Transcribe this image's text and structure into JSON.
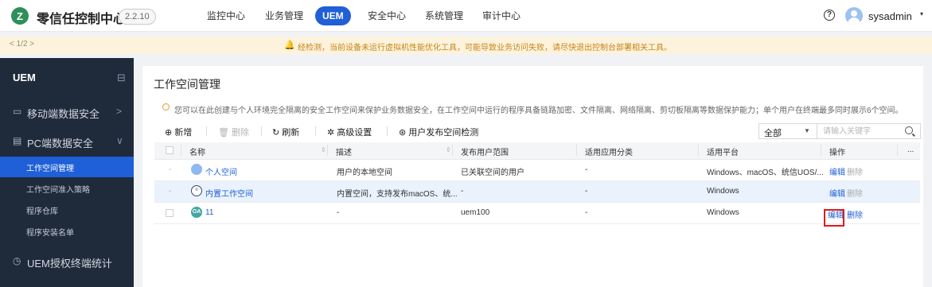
{
  "header": {
    "logo_letter": "Z",
    "title": "零信任控制中心",
    "version": "2.2.10",
    "nav": [
      "监控中心",
      "业务管理",
      "UEM",
      "安全中心",
      "系统管理",
      "审计中心"
    ],
    "active_nav": "UEM",
    "help_icon": "?",
    "username": "sysadmin",
    "caret": "▾"
  },
  "notice": {
    "pager": "< 1/2 >",
    "icon": "bell-icon",
    "text": "经检测，当前设备未运行虚拟机性能优化工具，可能导致业务访问失败，请尽快退出控制台部署相关工具。"
  },
  "sidebar": {
    "title": "UEM",
    "collapse_icon": "⊟",
    "items": [
      {
        "icon": "▭",
        "label": "移动端数据安全",
        "arrow": ">"
      },
      {
        "icon": "▤",
        "label": "PC端数据安全",
        "arrow": "∨"
      },
      {
        "icon": "◷",
        "label": "UEM授权终端统计",
        "arrow": ""
      }
    ],
    "subitems": [
      "工作空间管理",
      "工作空间准入策略",
      "程序仓库",
      "程序安装名单"
    ],
    "active_sub": "工作空间管理"
  },
  "main": {
    "title": "工作空间管理",
    "tip": "您可以在此创建与个人环境完全隔离的安全工作空间来保护业务数据安全，在工作空间中运行的程序具备链路加密、文件隔离、网络隔离、剪切板隔离等数据保护能力；单个用户在终端最多同时展示6个空间。",
    "toolbar": {
      "add": "新增",
      "delete": "删除",
      "refresh": "刷新",
      "advanced": "高级设置",
      "detect": "用户发布空间检测",
      "filter_value": "全部",
      "search_placeholder": "请输入关键字"
    },
    "table": {
      "columns": [
        "名称",
        "描述",
        "发布用户范围",
        "适用应用分类",
        "适用平台",
        "操作",
        "..."
      ],
      "rows": [
        {
          "check": "-",
          "icon": "user-icon",
          "name": "个人空间",
          "desc": "用户的本地空间",
          "scope": "已关联空间的用户",
          "category": "-",
          "platform": "Windows、macOS、统信UOS/...",
          "edit": "编辑",
          "delete": "删除",
          "delete_enabled": false
        },
        {
          "check": "-",
          "icon": "database-icon",
          "name": "内置工作空间",
          "desc": "内置空间，支持发布macOS、统...",
          "scope": "-",
          "category": "-",
          "platform": "Windows",
          "edit": "编辑",
          "delete": "删除",
          "delete_enabled": false
        },
        {
          "check": "",
          "icon": "oa-icon",
          "icon_text": "OA",
          "name": "11",
          "desc": "-",
          "scope": "uem100",
          "category": "-",
          "platform": "Windows",
          "edit": "编辑",
          "delete": "删除",
          "delete_enabled": true
        }
      ]
    }
  },
  "colors": {
    "primary": "#1f5fd8",
    "sidebar_bg": "#1f2a3b",
    "notice_bg": "#fdf3dd",
    "notice_text": "#c7851a",
    "highlight": "#e01a1a"
  }
}
